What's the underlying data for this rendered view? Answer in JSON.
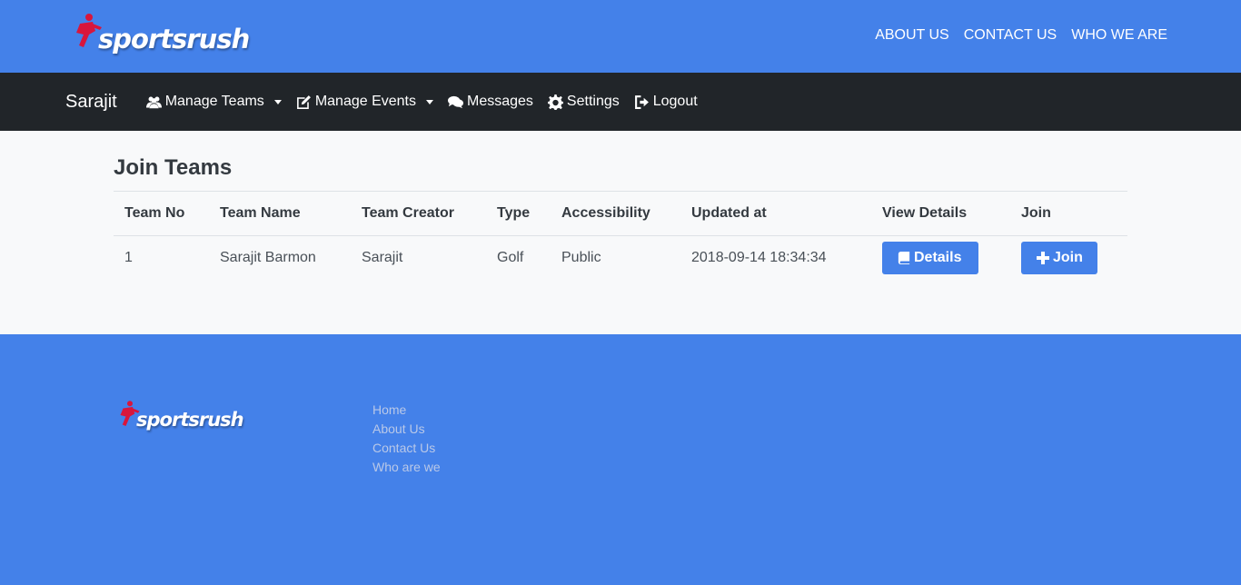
{
  "header": {
    "logo_text": "sportsrush",
    "nav": [
      "ABOUT US",
      "CONTACT US",
      "WHO WE ARE"
    ]
  },
  "user_nav": {
    "brand": "Sarajit",
    "items": [
      {
        "label": "Manage Teams",
        "icon": "users-icon",
        "dropdown": true
      },
      {
        "label": "Manage Events",
        "icon": "edit-icon",
        "dropdown": true
      },
      {
        "label": "Messages",
        "icon": "comments-icon",
        "dropdown": false
      },
      {
        "label": "Settings",
        "icon": "gear-icon",
        "dropdown": false
      },
      {
        "label": "Logout",
        "icon": "sign-out-icon",
        "dropdown": false
      }
    ]
  },
  "main": {
    "title": "Join Teams",
    "table": {
      "headers": [
        "Team No",
        "Team Name",
        "Team Creator",
        "Type",
        "Accessibility",
        "Updated at",
        "View Details",
        "Join"
      ],
      "rows": [
        {
          "no": "1",
          "name": "Sarajit Barmon",
          "creator": "Sarajit",
          "type": "Golf",
          "accessibility": "Public",
          "updated": "2018-09-14 18:34:34",
          "details_label": "Details",
          "join_label": "Join"
        }
      ]
    }
  },
  "footer": {
    "logo_text": "sportsrush",
    "links": [
      "Home",
      "About Us",
      "Contact Us",
      "Who are we"
    ]
  },
  "colors": {
    "primary": "#4481e9",
    "navbar": "#212529",
    "content_bg": "#f8f9fa",
    "footer_link": "#b9c8e8",
    "logo_red": "#d8163c"
  }
}
